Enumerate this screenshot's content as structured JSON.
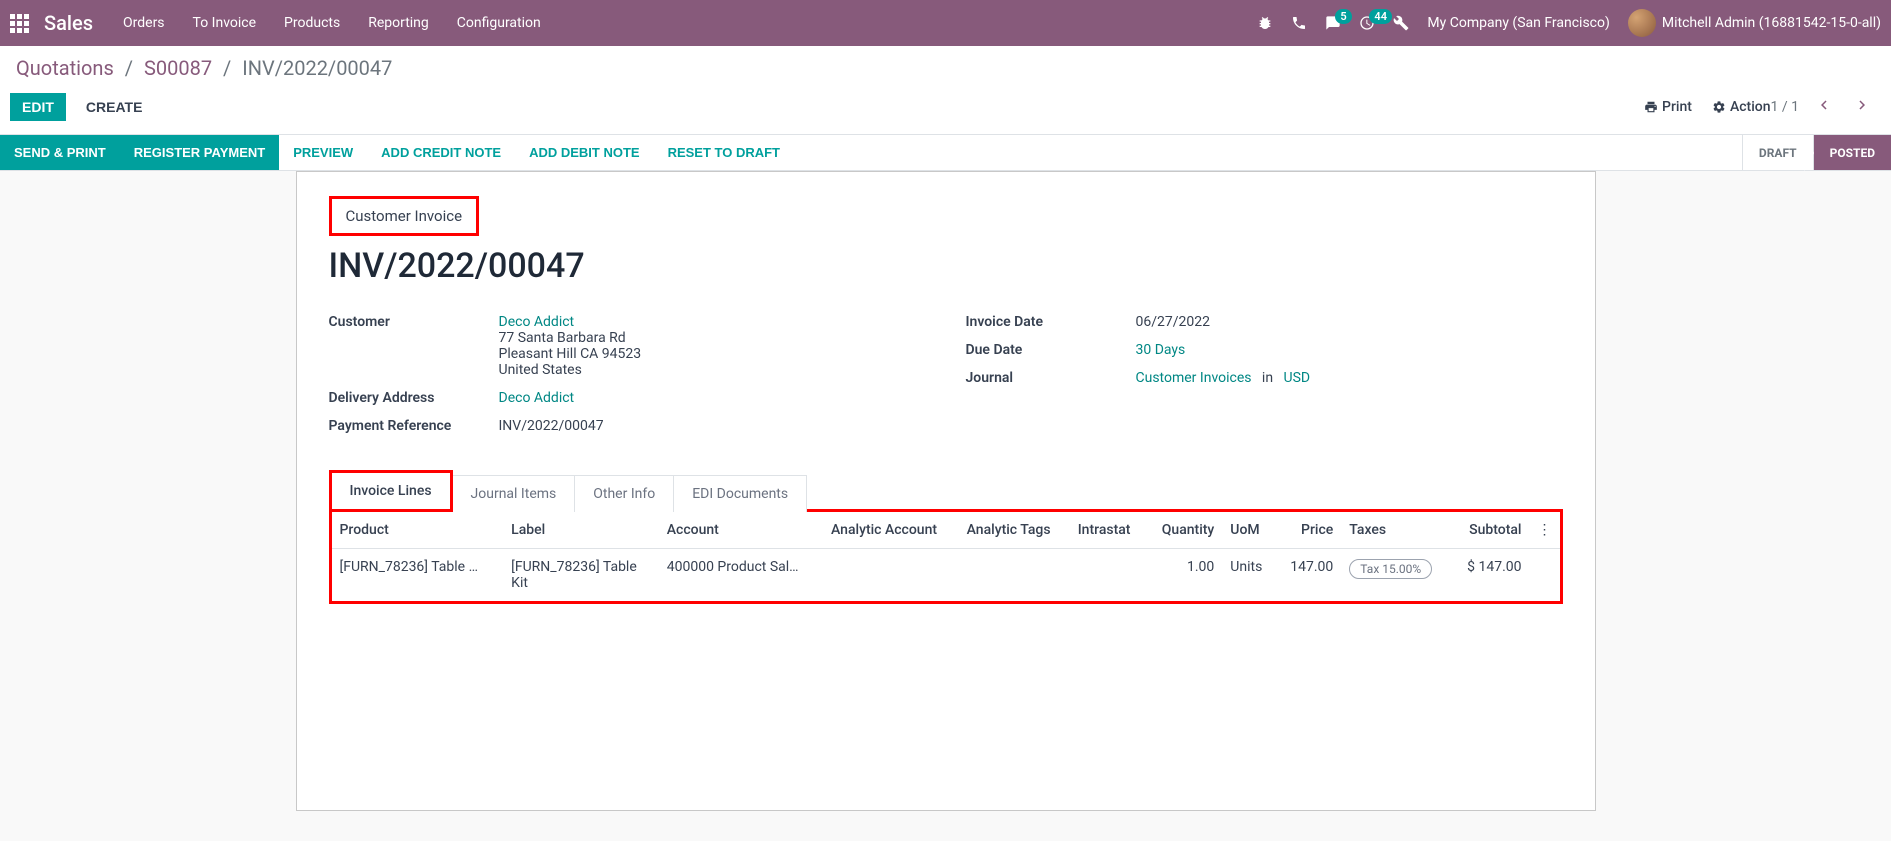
{
  "navbar": {
    "brand": "Sales",
    "menu": [
      "Orders",
      "To Invoice",
      "Products",
      "Reporting",
      "Configuration"
    ],
    "messages_badge": "5",
    "activities_badge": "44",
    "company": "My Company (San Francisco)",
    "user": "Mitchell Admin (16881542-15-0-all)"
  },
  "breadcrumb": {
    "root": "Quotations",
    "order": "S00087",
    "current": "INV/2022/00047"
  },
  "cp": {
    "edit": "EDIT",
    "create": "CREATE",
    "print": "Print",
    "action": "Action",
    "pager": "1 / 1"
  },
  "statusbar": {
    "buttons": [
      "SEND & PRINT",
      "REGISTER PAYMENT",
      "PREVIEW",
      "ADD CREDIT NOTE",
      "ADD DEBIT NOTE",
      "RESET TO DRAFT"
    ],
    "states": {
      "draft": "DRAFT",
      "posted": "POSTED"
    }
  },
  "form": {
    "doc_type": "Customer Invoice",
    "doc_title": "INV/2022/00047",
    "left": {
      "customer_label": "Customer",
      "customer_name": "Deco Addict",
      "address": [
        "77 Santa Barbara Rd",
        "Pleasant Hill CA 94523",
        "United States"
      ],
      "delivery_label": "Delivery Address",
      "delivery_value": "Deco Addict",
      "payref_label": "Payment Reference",
      "payref_value": "INV/2022/00047"
    },
    "right": {
      "invoice_date_label": "Invoice Date",
      "invoice_date_value": "06/27/2022",
      "due_date_label": "Due Date",
      "due_date_value": "30 Days",
      "journal_label": "Journal",
      "journal_value": "Customer Invoices",
      "journal_in": "in",
      "journal_currency": "USD"
    }
  },
  "tabs": [
    "Invoice Lines",
    "Journal Items",
    "Other Info",
    "EDI Documents"
  ],
  "table": {
    "headers": {
      "product": "Product",
      "label": "Label",
      "account": "Account",
      "analytic_account": "Analytic Account",
      "analytic_tags": "Analytic Tags",
      "intrastat": "Intrastat",
      "quantity": "Quantity",
      "uom": "UoM",
      "price": "Price",
      "taxes": "Taxes",
      "subtotal": "Subtotal"
    },
    "rows": [
      {
        "product": "[FURN_78236] Table …",
        "label": "[FURN_78236] Table Kit",
        "account": "400000 Product Sal…",
        "analytic_account": "",
        "analytic_tags": "",
        "intrastat": "",
        "quantity": "1.00",
        "uom": "Units",
        "price": "147.00",
        "taxes": "Tax 15.00%",
        "subtotal": "$ 147.00"
      }
    ]
  }
}
